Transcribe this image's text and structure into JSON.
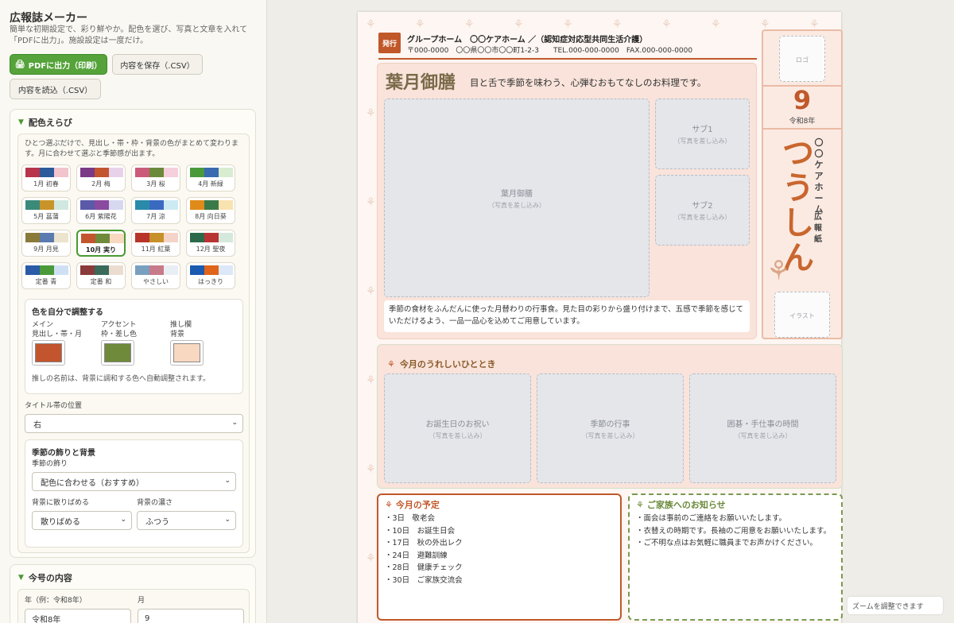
{
  "app": {
    "title": "広報誌メーカー",
    "description": "簡単な初期設定で、彩り鮮やか。配色を選び、写真と文章を入れて「PDFに出力」。施設設定は一度だけ。"
  },
  "toolbar": {
    "pdf_label": "PDFに出力（印刷）",
    "save_label": "内容を保存（.CSV）",
    "load_label": "内容を読込（.CSV）"
  },
  "color_panel": {
    "title": "配色えらび",
    "hint": "ひとつ選ぶだけで、見出し・帯・枠・背景の色がまとめて変わります。月に合わせて選ぶと季節感が出ます。",
    "swatches": [
      {
        "label": "1月 初春",
        "colors": [
          "#b8344a",
          "#2c5a9a",
          "#f2c4cc"
        ]
      },
      {
        "label": "2月 梅",
        "colors": [
          "#7a3a86",
          "#c3552e",
          "#e8d2ea"
        ]
      },
      {
        "label": "3月 桜",
        "colors": [
          "#cc5a7a",
          "#6a8a3a",
          "#f6cfdc"
        ]
      },
      {
        "label": "4月 新緑",
        "colors": [
          "#4a9a3a",
          "#3a6ab0",
          "#d8ecd0"
        ]
      },
      {
        "label": "5月 菖蒲",
        "colors": [
          "#3a8a7a",
          "#c8942a",
          "#d0e8e0"
        ]
      },
      {
        "label": "6月 紫陽花",
        "colors": [
          "#5a5aa8",
          "#8a4aa0",
          "#d6d8f0"
        ]
      },
      {
        "label": "7月 涼",
        "colors": [
          "#2a8aaa",
          "#3a6ac0",
          "#cceaf2"
        ]
      },
      {
        "label": "8月 向日葵",
        "colors": [
          "#e08a1a",
          "#3a7a4a",
          "#f8e2b0"
        ]
      },
      {
        "label": "9月 月見",
        "colors": [
          "#8a7a3a",
          "#5a7ab0",
          "#ece4cc"
        ]
      },
      {
        "label": "10月 実り",
        "colors": [
          "#c3552e",
          "#6f8a3a",
          "#f8d8c0"
        ]
      },
      {
        "label": "11月 紅葉",
        "colors": [
          "#b8342a",
          "#c8902a",
          "#f4d4c8"
        ]
      },
      {
        "label": "12月 聖夜",
        "colors": [
          "#2a6a4a",
          "#b83434",
          "#d4e8dc"
        ]
      },
      {
        "label": "定番 青",
        "colors": [
          "#2a5aa8",
          "#4a9a3a",
          "#d0e0f4"
        ]
      },
      {
        "label": "定番 和",
        "colors": [
          "#8a3a3a",
          "#3a6a5a",
          "#ecdcd0"
        ]
      },
      {
        "label": "やさしい",
        "colors": [
          "#7aa0c0",
          "#c87a8a",
          "#e8eef4"
        ]
      },
      {
        "label": "はっきり",
        "colors": [
          "#1a5ab0",
          "#e0641a",
          "#dce8f8"
        ]
      }
    ],
    "custom": {
      "title": "色を自分で調整する",
      "main_label": "メイン\n見出し・帯・月",
      "accent_label": "アクセント\n枠・差し色",
      "push_label": "推し欄\n背景",
      "main_color": "#c3552e",
      "accent_color": "#6f8a3a",
      "push_color": "#f8d8c0",
      "note": "推しの名前は、背景に調和する色へ自動調整されます。"
    },
    "band_position": {
      "label": "タイトル帯の位置",
      "value": "右"
    },
    "season": {
      "title": "季節の飾りと背景",
      "decor_label": "季節の飾り",
      "decor_value": "配色に合わせる（おすすめ）",
      "scatter_label": "背景に散りばめる",
      "scatter_value": "散りばめる",
      "density_label": "背景の濃さ",
      "density_value": "ふつう"
    }
  },
  "issue_panel": {
    "title": "今号の内容",
    "year_label": "年（例：令和8年）",
    "year_value": "令和8年",
    "month_label": "月",
    "month_value": "9"
  },
  "paper": {
    "publisher_tag": "発行",
    "publisher_name": "グループホーム　〇〇ケアホーム ／（認知症対応型共同生活介護）",
    "publisher_addr": "〒000-0000　〇〇県〇〇市〇〇町1-2-3　　TEL.000-000-0000　FAX.000-000-0000",
    "feature": {
      "title": "葉月御膳",
      "subtitle": "目と舌で季節を味わう、心弾むおもてなしのお料理です。",
      "main_photo": "葉月御膳",
      "sub1": "サブ1",
      "sub2": "サブ2",
      "placeholder": "（写真を差し込み）",
      "desc": "季節の食材をふんだんに使った月替わりの行事食。見た目の彩りから盛り付けまで、五感で季節を感じていただけるよう、一品一品心を込めてご用意しています。"
    },
    "side": {
      "logo": "ロゴ",
      "month": "9",
      "era": "令和8年",
      "big": "つうしん",
      "facility": "〇〇ケアホーム",
      "paper_kind": "広報紙",
      "illust": "イラスト"
    },
    "moments": {
      "title": "今月のうれしいひととき",
      "photos": [
        "お誕生日のお祝い",
        "季節の行事",
        "囲碁・手仕事の時間"
      ],
      "placeholder": "（写真を差し込み）"
    },
    "schedule": {
      "title": "今月の予定",
      "items": [
        "・3日　敬老会",
        "・10日　お誕生日会",
        "・17日　秋の外出レク",
        "・24日　避難訓練",
        "・28日　健康チェック",
        "・30日　ご家族交流会"
      ]
    },
    "notice": {
      "title": "ご家族へのお知らせ",
      "items": [
        "・面会は事前のご連絡をお願いいたします。",
        "・衣替えの時期です。長袖のご用意をお願いいたします。",
        "・ご不明な点はお気軽に職員までお声かけください。"
      ]
    }
  },
  "zoom_hint": "ズームを調整できます"
}
